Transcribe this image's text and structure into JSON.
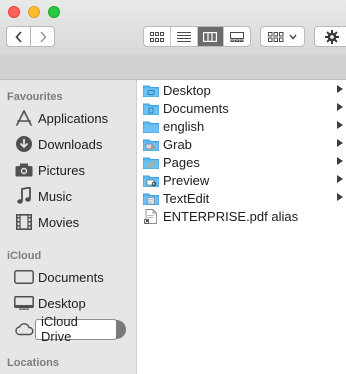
{
  "sidebar": {
    "favourites_heading": "Favourites",
    "favourites": [
      {
        "label": "Applications",
        "icon": "applications-icon"
      },
      {
        "label": "Downloads",
        "icon": "downloads-icon"
      },
      {
        "label": "Pictures",
        "icon": "camera-icon"
      },
      {
        "label": "Music",
        "icon": "music-note-icon"
      },
      {
        "label": "Movies",
        "icon": "film-icon"
      }
    ],
    "icloud_heading": "iCloud",
    "icloud": [
      {
        "label": "Documents",
        "icon": "document-icon"
      },
      {
        "label": "Desktop",
        "icon": "desktop-icon"
      }
    ],
    "selected": {
      "label": "iCloud Drive",
      "icon": "cloud-icon"
    },
    "locations_heading": "Locations"
  },
  "column": {
    "items": [
      {
        "name": "Desktop",
        "type": "folder",
        "has_children": true
      },
      {
        "name": "Documents",
        "type": "folder",
        "has_children": true
      },
      {
        "name": "english",
        "type": "folder",
        "has_children": true
      },
      {
        "name": "Grab",
        "type": "folder",
        "has_children": true
      },
      {
        "name": "Pages",
        "type": "folder",
        "has_children": true
      },
      {
        "name": "Preview",
        "type": "folder",
        "has_children": true
      },
      {
        "name": "TextEdit",
        "type": "folder",
        "has_children": true
      },
      {
        "name": "ENTERPRISE.pdf alias",
        "type": "alias",
        "has_children": false
      }
    ]
  },
  "colors": {
    "folder": "#5ab4ee",
    "folder_tab": "#3f9fe0",
    "accent": "#0a84ff"
  }
}
